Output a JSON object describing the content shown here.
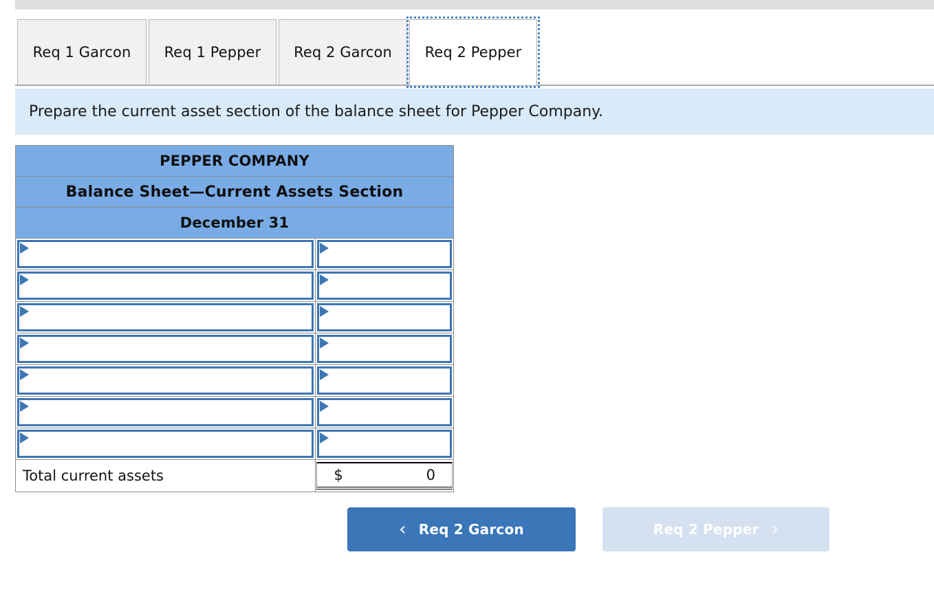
{
  "tabs": [
    {
      "label": "Req 1 Garcon",
      "active": false
    },
    {
      "label": "Req 1 Pepper",
      "active": false
    },
    {
      "label": "Req 2 Garcon",
      "active": false
    },
    {
      "label": "Req 2 Pepper",
      "active": true
    }
  ],
  "banner": {
    "instruction": "Prepare the current asset section of the balance sheet for Pepper Company."
  },
  "sheet": {
    "title": "PEPPER COMPANY",
    "subtitle": "Balance Sheet—Current Assets Section",
    "date": "December 31",
    "rows": [
      {
        "description": "",
        "amount": ""
      },
      {
        "description": "",
        "amount": ""
      },
      {
        "description": "",
        "amount": ""
      },
      {
        "description": "",
        "amount": ""
      },
      {
        "description": "",
        "amount": ""
      },
      {
        "description": "",
        "amount": ""
      },
      {
        "description": "",
        "amount": ""
      }
    ],
    "total": {
      "label": "Total current assets",
      "currency": "$",
      "value": "0"
    }
  },
  "nav": {
    "prev_label": "Req 2 Garcon",
    "prev_icon": "chevron-left-icon",
    "next_label": "Req 2 Pepper",
    "next_icon": "chevron-right-icon",
    "prev_chevron": "‹",
    "next_chevron": "›"
  },
  "colors": {
    "header_blue": "#79ace6",
    "banner_blue": "#d9eaf9",
    "input_border": "#3d76b5",
    "button_blue": "#3a76b8",
    "button_disabled": "#d5e1f0",
    "tab_inactive": "#f1f1f1",
    "top_strip": "#e0e0e0"
  }
}
